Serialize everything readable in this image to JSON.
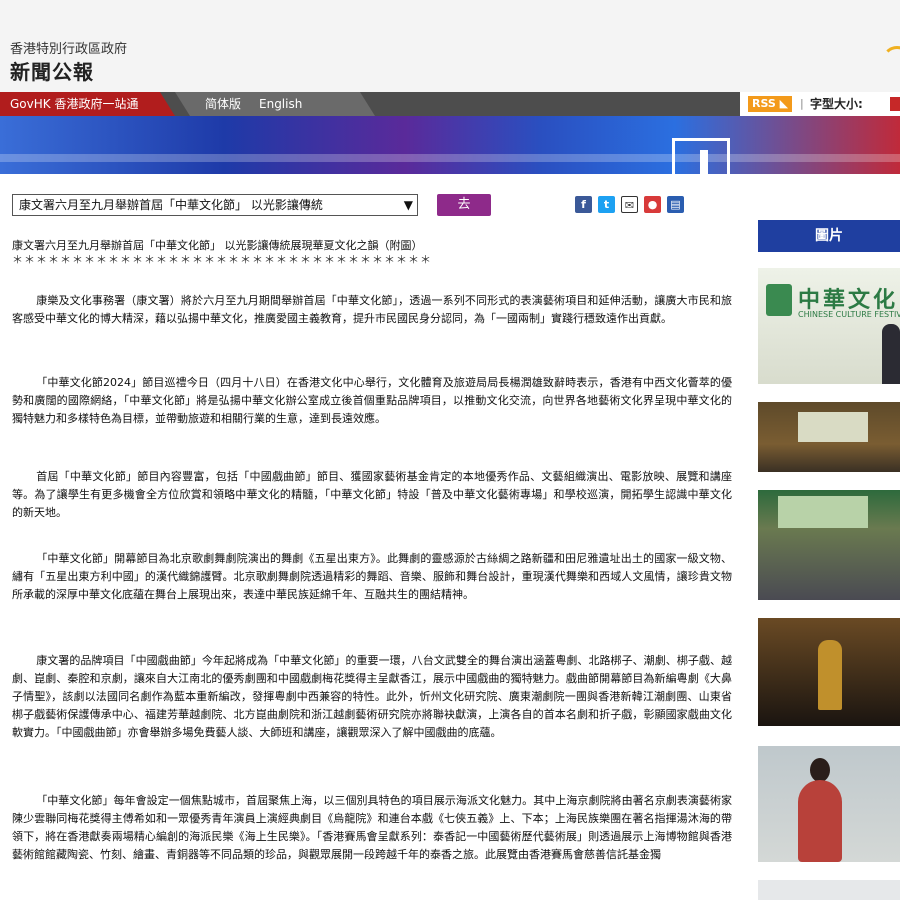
{
  "header": {
    "gov_name": "香港特別行政區政府",
    "site_title": "新聞公報"
  },
  "nav": {
    "govhk": "GovHK 香港政府一站通",
    "simplified": "简体版",
    "english": "English",
    "rss": "RSS",
    "font_size_label": "字型大小:"
  },
  "toolbar": {
    "select_value": "康文署六月至九月舉辦首屆「中華文化節」 以光影讓傳統",
    "go_label": "去"
  },
  "share_icons": [
    "facebook-icon",
    "twitter-icon",
    "email-icon",
    "weibo-icon",
    "print-icon"
  ],
  "sidebar": {
    "heading": "圖片",
    "thumb1_cn": "中華文化",
    "thumb1_en": "CHINESE CULTURE FESTIVAL"
  },
  "article": {
    "title": "康文署六月至九月舉辦首屆「中華文化節」 以光影讓傳統展現華夏文化之韻（附圖）",
    "stars": "＊＊＊＊＊＊＊＊＊＊＊＊＊＊＊＊＊＊＊＊＊＊＊＊＊＊＊＊＊＊＊＊＊＊＊",
    "paragraphs": [
      "康樂及文化事務署（康文署）將於六月至九月期間舉辦首屆「中華文化節」，透過一系列不同形式的表演藝術項目和延伸活動，讓廣大市民和旅客感受中華文化的博大精深，藉以弘揚中華文化，推廣愛國主義教育，提升市民國民身分認同，為「一國兩制」實踐行穩致遠作出貢獻。",
      "「中華文化節2024」節目巡禮今日（四月十八日）在香港文化中心舉行，文化體育及旅遊局局長楊潤雄致辭時表示，香港有中西文化薈萃的優勢和廣闊的國際網絡，「中華文化節」將是弘揚中華文化辦公室成立後首個重點品牌項目，以推動文化交流，向世界各地藝術文化界呈現中華文化的獨特魅力和多樣特色為目標，並帶動旅遊和相關行業的生意，達到長遠效應。",
      "首屆「中華文化節」節目內容豐富，包括「中國戲曲節」節目、獲國家藝術基金肯定的本地優秀作品、文藝組織演出、電影放映、展覽和講座等。為了讓學生有更多機會全方位欣賞和領略中華文化的精髓，「中華文化節」特設「普及中華文化藝術專場」和學校巡演，開拓學生認識中華文化的新天地。",
      "「中華文化節」開幕節目為北京歌劇舞劇院演出的舞劇《五星出東方》。此舞劇的靈感源於古絲綢之路新疆和田尼雅遺址出土的國家一級文物、繡有「五星出東方利中國」的漢代織錦護臂。北京歌劇舞劇院透過精彩的舞蹈、音樂、服飾和舞台設計，重現漢代舞樂和西域人文風情，讓珍貴文物所承載的深厚中華文化底蘊在舞台上展現出來，表達中華民族延綿千年、互融共生的團結精神。",
      "康文署的品牌項目「中國戲曲節」今年起將成為「中華文化節」的重要一環，八台文武雙全的舞台演出涵蓋粵劇、北路梆子、潮劇、梆子戲、越劇、崑劇、秦腔和京劇，讓來自大江南北的優秀劇團和中國戲劇梅花獎得主呈獻香江，展示中國戲曲的獨特魅力。戲曲節開幕節目為新編粵劇《大鼻子情聖》，該劇以法國同名劇作為藍本重新編改，發揮粵劇中西兼容的特性。此外，忻州文化研究院、廣東潮劇院一團與香港新韓江潮劇團、山東省梆子戲藝術保護傳承中心、福建芳華越劇院、北方崑曲劇院和浙江越劇藝術研究院亦將聯袂獻演，上演各自的首本名劇和折子戲，彰顯國家戲曲文化軟實力。「中國戲曲節」亦會舉辦多場免費藝人談、大師班和講座，讓觀眾深入了解中國戲曲的底蘊。",
      "「中華文化節」每年會設定一個焦點城市，首屆聚焦上海，以三個別具特色的項目展示海派文化魅力。其中上海京劇院將由著名京劇表演藝術家陳少雲聯同梅花獎得主傅希如和一眾優秀青年演員上演經典劇目《烏龍院》和連台本戲《七俠五義》上、下本；上海民族樂團在著名指揮湯沐海的帶領下，將在香港獻奏兩場精心編創的海派民樂《海上生民樂》。「香港賽馬會呈獻系列：泰香記一中國藝術歷代藝術展」則透過展示上海博物館與香港藝術館館藏陶瓷、竹刻、繪畫、青銅器等不同品類的珍品，與觀眾展開一段跨越千年的泰香之旅。此展覽由香港賽馬會慈善信託基金獨"
    ]
  }
}
